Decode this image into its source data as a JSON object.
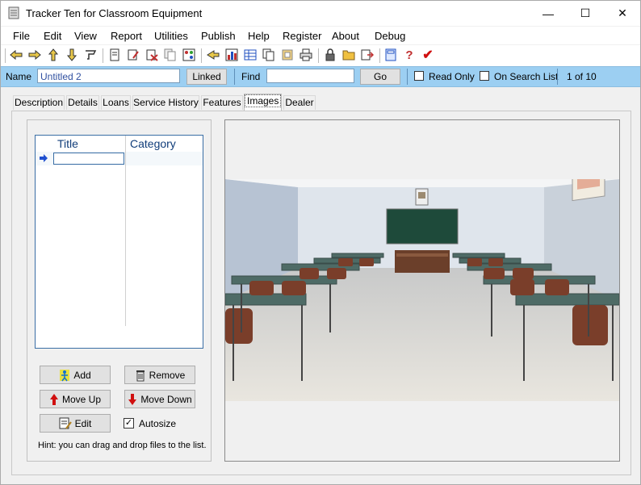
{
  "window": {
    "title": "Tracker Ten for Classroom Equipment",
    "controls": {
      "minimize": "—",
      "maximize": "☐",
      "close": "✕"
    }
  },
  "menu": [
    "File",
    "Edit",
    "View",
    "Report",
    "Utilities",
    "Publish",
    "Help",
    "Register",
    "About",
    "Debug"
  ],
  "toolbar": [
    "first-record-icon",
    "previous-record-icon",
    "next-record-icon",
    "last-record-icon",
    "filter-icon",
    "new-record-icon",
    "edit-record-icon",
    "delete-record-icon",
    "copy-record-icon",
    "random-icon",
    "goto-icon",
    "chart-icon",
    "table-icon",
    "pages-icon",
    "stamp-icon",
    "print-icon",
    "lock-icon",
    "open-folder-icon",
    "export-icon",
    "calculator-icon",
    "help-icon",
    "check-icon"
  ],
  "namebar": {
    "name_label": "Name",
    "name_value": "Untitled 2",
    "linked_label": "Linked",
    "find_label": "Find",
    "find_value": "",
    "go_label": "Go",
    "read_only_label": "Read Only",
    "on_search_list_label": "On Search List",
    "record_position": "1 of 10"
  },
  "tabs": [
    "Description",
    "Details",
    "Loans",
    "Service History",
    "Features",
    "Images",
    "Dealer"
  ],
  "active_tab": "Images",
  "images": {
    "columns": [
      "Title",
      "Category"
    ],
    "rows": [],
    "buttons": {
      "add": "Add",
      "remove": "Remove",
      "move_up": "Move Up",
      "move_down": "Move Down",
      "edit": "Edit"
    },
    "autosize_label": "Autosize",
    "autosize_checked": true,
    "hint": "Hint: you can drag and drop files to the list."
  },
  "colors": {
    "namebar_bg": "#9ccff2",
    "accent": "#3a6ea5"
  }
}
